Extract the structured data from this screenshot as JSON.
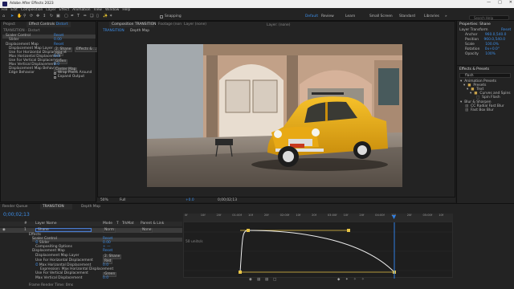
{
  "window": {
    "title": "Adobe After Effects 2023"
  },
  "menu": [
    "File",
    "Edit",
    "Composition",
    "Layer",
    "Effect",
    "Animation",
    "View",
    "Window",
    "Help"
  ],
  "toolbar": {
    "snapping": "Snapping",
    "workspaces": [
      "Default",
      "Review",
      "Learn",
      "Small Screen",
      "Standard",
      "Libraries"
    ],
    "search_placeholder": "Search Help"
  },
  "effect_controls": {
    "tabs": [
      "Project",
      "Effect Controls",
      "Distort"
    ],
    "breadcrumb": "TRANSITION · Distort",
    "fx_name": "Displacement Map",
    "reset": "Reset",
    "about": "About",
    "rows": [
      {
        "label": "Scaler Control",
        "value": "Reset"
      },
      {
        "label": "Slider",
        "value": "0.00"
      },
      {
        "label": "Displacement Map",
        "value": "Reset"
      },
      {
        "label": "Displacement Map Layer",
        "value": "2. Shane",
        "extra": "Effects & ..."
      },
      {
        "label": "Use For Horizontal Displacement",
        "value": "Red"
      },
      {
        "label": "Max Horizontal Displacement",
        "value": "0.0"
      },
      {
        "label": "Use For Vertical Displacement",
        "value": "Green"
      },
      {
        "label": "Max Vertical Displacement",
        "value": "0.0"
      },
      {
        "label": "Displacement Map Behavior",
        "value": "Center Map"
      },
      {
        "label": "Edge Behavior",
        "value": "Wrap Pixels Around"
      },
      {
        "label": "",
        "value": "Expand Output"
      }
    ]
  },
  "composition": {
    "tab": "Composition TRANSITION",
    "footage": "Footage (none)",
    "layer": "Layer (none)",
    "subtabs": [
      "TRANSITION",
      "Depth Map"
    ],
    "zoom": "50%",
    "quality": "Full",
    "timecode": "0;00;02;13",
    "active_camera": "Active Camera",
    "view": "1 View",
    "offset": "+0.0"
  },
  "timeline": {
    "tabs": [
      "Render Queue",
      "TRANSITION",
      "Depth Map"
    ],
    "timecode": "0;00;02;13",
    "columns": [
      "#",
      "Layer Name",
      "Mode",
      "T",
      "TrkMat",
      "Parent & Link"
    ],
    "layers": [
      {
        "num": "1",
        "name": "Shane",
        "mode": "Norm",
        "parent": "None"
      },
      {
        "label": "Effects"
      },
      {
        "label": "Scaler Control",
        "value": "Reset"
      },
      {
        "label": "Slider",
        "value": "0.00"
      },
      {
        "label": "Compositing Options",
        "value": "+ —"
      },
      {
        "label": "Displacement Map",
        "value": "Reset"
      },
      {
        "label": "Displacement Map Layer",
        "value": "2. Shane"
      },
      {
        "label": "Use For Horizontal Displacement",
        "value": "Red"
      },
      {
        "label": "Max Horizontal Displacement",
        "value": "0.0"
      },
      {
        "label": "Expression: Max Horizontal Displacement"
      },
      {
        "label": "Use For Vertical Displacement",
        "value": "Green"
      },
      {
        "label": "Max Vertical Displacement",
        "value": "0.0"
      }
    ],
    "footer": "Frame Render Time: 0ms",
    "ruler": [
      "0f",
      "10f",
      "20f",
      "01:00f",
      "10f",
      "20f",
      "02:00f",
      "10f",
      "20f",
      "03:00f",
      "10f",
      "20f",
      "04:00f",
      "10f",
      "20f",
      "05:00f",
      "10f"
    ],
    "graph_label": "50 units/s"
  },
  "properties": {
    "title": "Properties: Shane",
    "section": "Layer Transform",
    "reset": "Reset",
    "rows": [
      {
        "label": "Anchor",
        "value": "960.0,540.0"
      },
      {
        "label": "Position",
        "value": "960.0,540.0"
      },
      {
        "label": "Scale",
        "value": "100.0%"
      },
      {
        "label": "Rotation",
        "value": "0x+0.0°"
      },
      {
        "label": "Opacity",
        "value": "100%"
      }
    ]
  },
  "effects_presets": {
    "title": "Effects & Presets",
    "search": "flash",
    "items": [
      "Animation Presets",
      "Presets",
      "Text",
      "Curves and Spins",
      "Spin Flash",
      "Blur & Sharpen",
      "CC Radial Fast Blur",
      "Fast Box Blur"
    ]
  },
  "colors": {
    "accent": "#3d8ee8",
    "keyframe": "#e8c547",
    "playhead": "#2f7fe3",
    "curve": "#eeeeee"
  }
}
